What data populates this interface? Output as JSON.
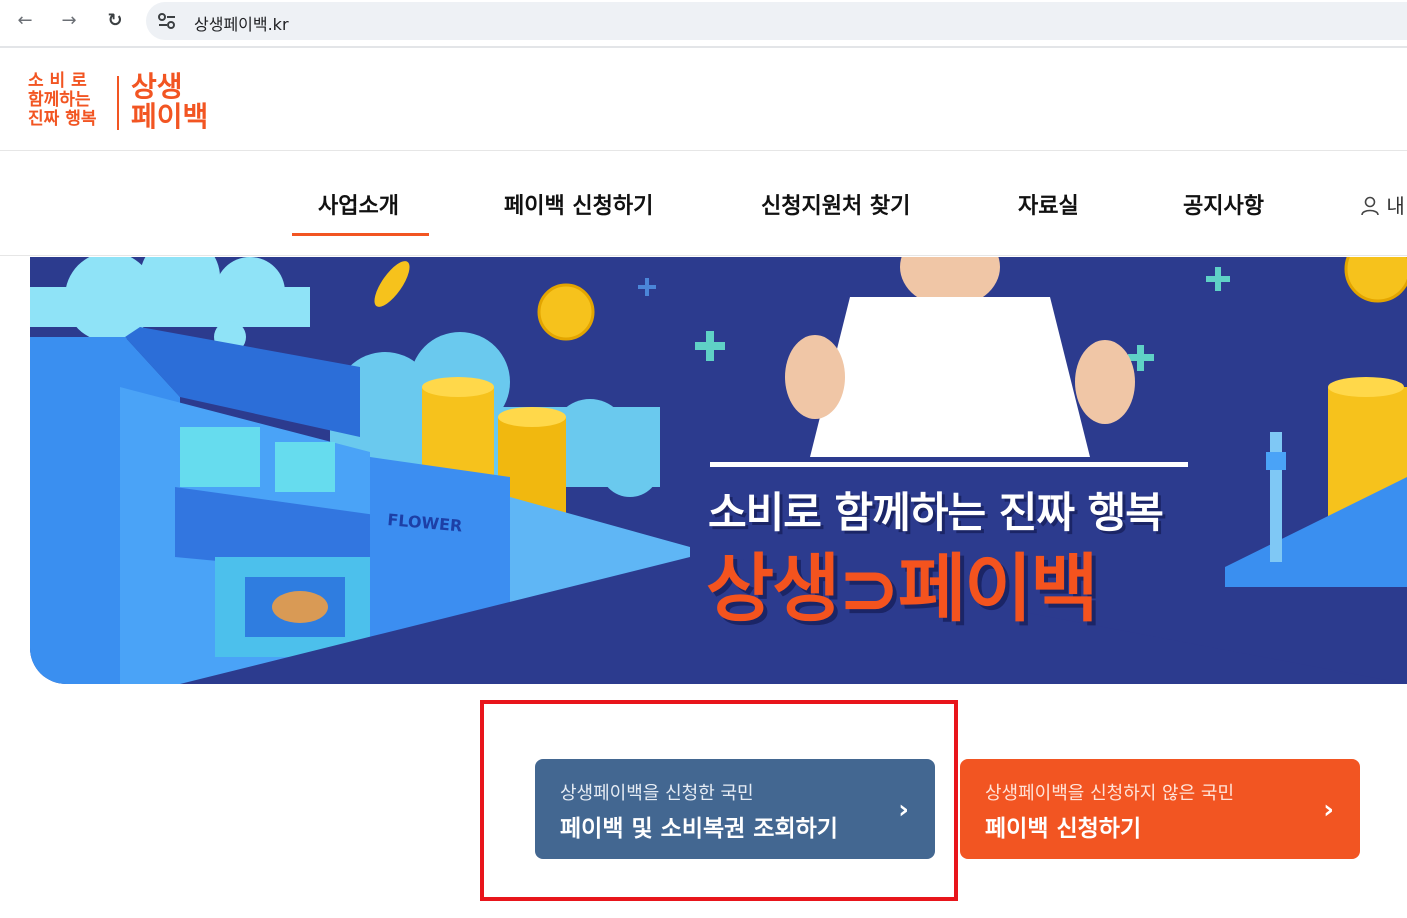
{
  "browser": {
    "url": "상생페이백.kr",
    "back_icon": "arrow-left-icon",
    "forward_icon": "arrow-right-icon",
    "reload_icon": "reload-icon"
  },
  "header": {
    "logo_tagline": [
      "소 비 로",
      "함께하는",
      "진짜 행복"
    ],
    "logo_main": [
      "상생",
      "페이백"
    ],
    "brand_color": "#f25522"
  },
  "nav": {
    "items": [
      "사업소개",
      "페이백 신청하기",
      "신청지원처 찾기",
      "자료실",
      "공지사항"
    ],
    "active_index": 0,
    "mypage_label": "내"
  },
  "banner": {
    "tagline": "소비로 함께하는 진짜 행복",
    "brand": "상생⊃페이백",
    "store_sign": "FLOWER"
  },
  "cta": {
    "inquiry": {
      "subtitle": "상생페이백을 신청한 국민",
      "title": "페이백 및 소비복권 조회하기",
      "color": "#436791"
    },
    "apply": {
      "subtitle": "상생페이백을 신청하지 않은 국민",
      "title": "페이백 신청하기",
      "color": "#f25522"
    }
  },
  "highlight_color": "#e8151b"
}
